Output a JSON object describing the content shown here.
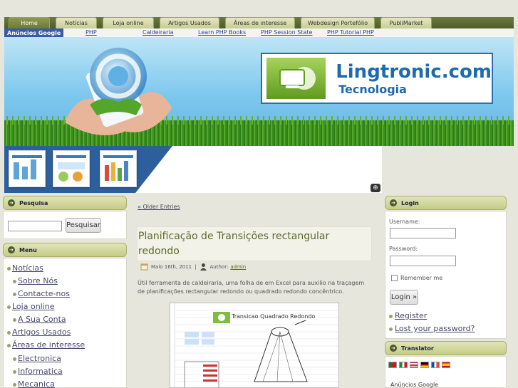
{
  "nav": {
    "tabs": [
      "Home",
      "Notícias",
      "Loja online",
      "Artigos Usados",
      "Áreas de interesse",
      "Webdesign Portefólio",
      "PubliMarket"
    ],
    "active": "Home"
  },
  "ads": {
    "label": "Anúncios Google",
    "links": [
      "PHP",
      "Caldeiraria",
      "Learn PHP Books",
      "PHP Session State",
      "PHP Tutorial PHP"
    ]
  },
  "logo": {
    "title": "Lingtronic.com",
    "subtitle": "Tecnologia"
  },
  "sidebar_left": {
    "search": {
      "title": "Pesquisa",
      "button": "Pesquisar",
      "value": ""
    },
    "menu": {
      "title": "Menu",
      "items": [
        {
          "label": "Notícias",
          "level": 0
        },
        {
          "label": "Sobre Nós",
          "level": 1
        },
        {
          "label": "Contacte-nos",
          "level": 1
        },
        {
          "label": "Loja online",
          "level": 0
        },
        {
          "label": "A Sua Conta",
          "level": 1
        },
        {
          "label": "Artigos Usados",
          "level": 0
        },
        {
          "label": "Áreas de interesse",
          "level": 0
        },
        {
          "label": "Electronica",
          "level": 1
        },
        {
          "label": "Informatica",
          "level": 1
        },
        {
          "label": "Mecanica",
          "level": 1
        }
      ]
    }
  },
  "content": {
    "older_entries": "« Older Entries",
    "post": {
      "title": "Planificação de Transições rectangular redondo",
      "date": "Maio 16th, 2011",
      "separator": "|",
      "author_label": "Author:",
      "author": "admin",
      "excerpt": "Útil ferramenta de caldeiraria, uma folha de em Excel para auxilio na traçagem de planificações rectangular redondo ou quadrado redondo concêntrico.",
      "image_title": "Transicao Quadrado Redondo"
    }
  },
  "sidebar_right": {
    "login": {
      "title": "Login",
      "username_label": "Username:",
      "password_label": "Password:",
      "remember_label": "Remember me",
      "button": "Login »",
      "links": [
        "Register",
        "Lost your password?"
      ]
    },
    "translator": {
      "title": "Translator"
    },
    "ads_label": "Anúncios Google"
  },
  "colors": {
    "nav": "#5a6a32",
    "accent_green": "#5a6a2a",
    "logo_blue": "#1e6aae",
    "ads_blue": "#3a5aa8"
  }
}
